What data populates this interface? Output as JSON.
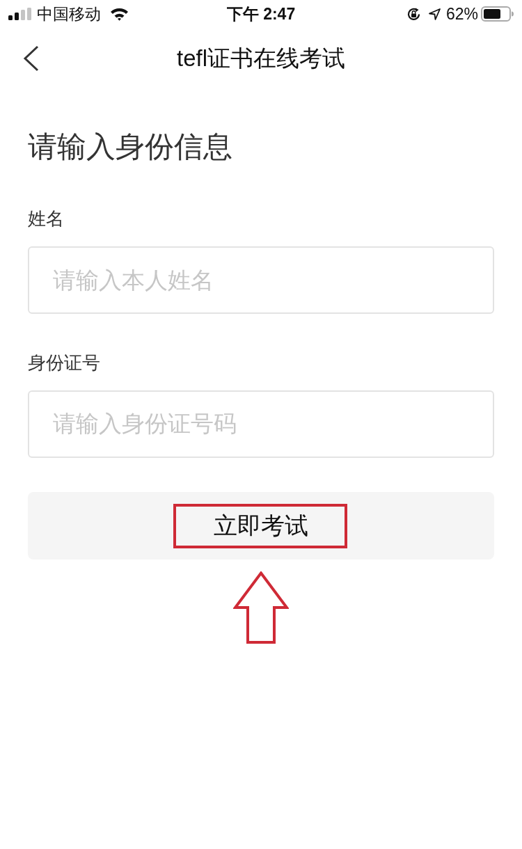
{
  "status_bar": {
    "carrier": "中国移动",
    "time": "下午 2:47",
    "battery_text": "62%"
  },
  "nav": {
    "title": "tefl证书在线考试"
  },
  "form": {
    "heading": "请输入身份信息",
    "fields": [
      {
        "label": "姓名",
        "placeholder": "请输入本人姓名"
      },
      {
        "label": "身份证号",
        "placeholder": "请输入身份证号码"
      }
    ],
    "submit": {
      "label": "立即考试",
      "highlighted": true,
      "pointer_arrow": true
    }
  }
}
